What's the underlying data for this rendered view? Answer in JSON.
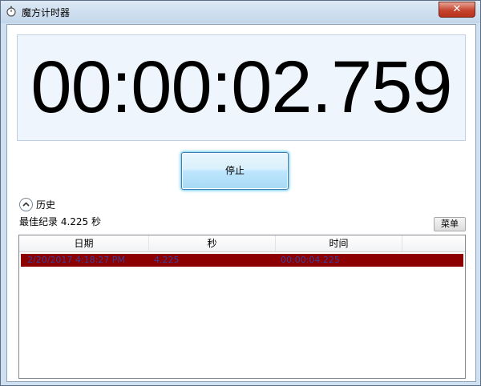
{
  "window": {
    "title": "魔方计时器",
    "close_glyph": "✕"
  },
  "timer": {
    "display": "00:00:02.759"
  },
  "controls": {
    "stop_label": "停止"
  },
  "history": {
    "label": "历史",
    "best_record": "最佳纪录 4.225 秒",
    "menu_label": "菜单",
    "columns": [
      "日期",
      "秒",
      "时间"
    ],
    "rows": [
      {
        "date": "2/20/2017 4:18:27 PM",
        "seconds": "4.225",
        "time": "00:00:04.225"
      }
    ],
    "selected_row_color": "#8c0000",
    "selected_text_color": "#3a3f9c"
  },
  "icons": {
    "app": "stopwatch-icon",
    "toggle": "chevron-up-icon",
    "close": "close-icon"
  }
}
